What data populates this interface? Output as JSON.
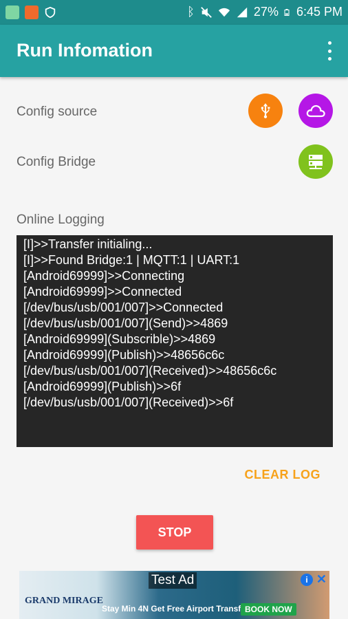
{
  "status_bar": {
    "battery": "27%",
    "time": "6:45 PM"
  },
  "app_bar": {
    "title": "Run Infomation",
    "menu_icon": "overflow-menu-icon"
  },
  "config_source": {
    "label": "Config source",
    "usb_icon": "usb-icon",
    "cloud_icon": "cloud-icon"
  },
  "config_bridge": {
    "label": "Config Bridge",
    "server_icon": "server-icon"
  },
  "logging": {
    "label": "Online Logging",
    "lines": [
      "[I]>>Transfer initialing...",
      "[I]>>Found Bridge:1 | MQTT:1 | UART:1",
      "[Android69999]>>Connecting",
      "[Android69999]>>Connected",
      "[/dev/bus/usb/001/007]>>Connected",
      "[/dev/bus/usb/001/007](Send)>>4869",
      "[Android69999](Subscrible)>>4869",
      "[Android69999](Publish)>>48656c6c",
      "[/dev/bus/usb/001/007](Received)>>48656c6c",
      "[Android69999](Publish)>>6f",
      "[/dev/bus/usb/001/007](Received)>>6f"
    ],
    "clear_label": "CLEAR LOG"
  },
  "stop_label": "STOP",
  "ad": {
    "title": "Test Ad",
    "brand": "GRAND MIRAGE",
    "tagline": "Stay Min 4N Get Free Airport Transfer",
    "cta": "BOOK NOW"
  },
  "colors": {
    "status_bar": "#1e8c8c",
    "app_bar": "#26a2a2",
    "usb_button": "#f7820f",
    "cloud_button": "#b517e6",
    "server_button": "#80c21d",
    "stop_button": "#f35454",
    "clear_log": "#f7a21b",
    "log_background": "#262626"
  }
}
